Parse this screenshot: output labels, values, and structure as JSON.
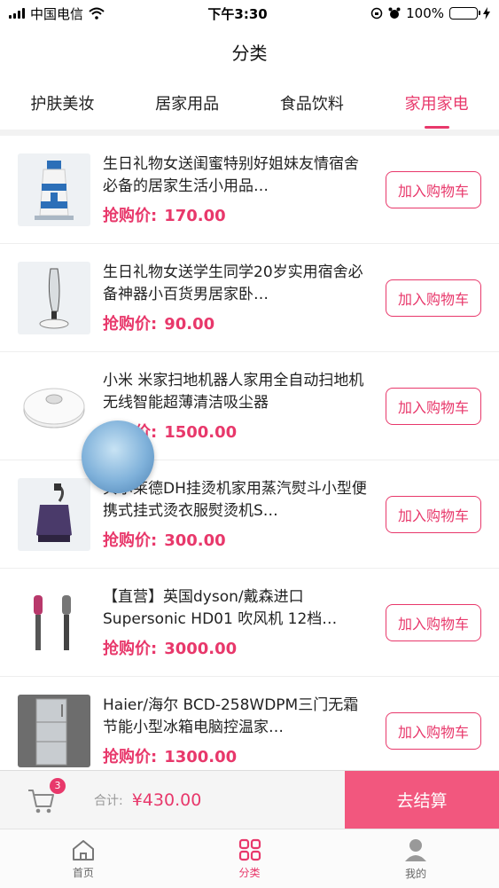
{
  "status_bar": {
    "carrier": "中国电信",
    "time": "下午3:30",
    "battery": "100%"
  },
  "header": {
    "title": "分类"
  },
  "tabs": [
    {
      "label": "护肤美妆",
      "active": false
    },
    {
      "label": "居家用品",
      "active": false
    },
    {
      "label": "食品饮料",
      "active": false
    },
    {
      "label": "家用家电",
      "active": true
    }
  ],
  "products": [
    {
      "title": "生日礼物女送闺蜜特别好姐妹友情宿舍必备的居家生活小用品…",
      "price_label": "抢购价:",
      "price": "170.00",
      "button": "加入购物车",
      "icon": "lighthouse-humidifier-icon"
    },
    {
      "title": "生日礼物女送学生同学20岁实用宿舍必备神器小百货男居家卧…",
      "price_label": "抢购价:",
      "price": "90.00",
      "button": "加入购物车",
      "icon": "tower-fan-icon"
    },
    {
      "title": "小米 米家扫地机器人家用全自动扫地机无线智能超薄清洁吸尘器",
      "price_label": "抢购价:",
      "price": "1500.00",
      "button": "加入购物车",
      "icon": "robot-vacuum-icon"
    },
    {
      "title": "贝尔莱德DH挂烫机家用蒸汽熨斗小型便携式挂式烫衣服熨烫机S…",
      "price_label": "抢购价:",
      "price": "300.00",
      "button": "加入购物车",
      "icon": "garment-steamer-icon"
    },
    {
      "title": "【直营】英国dyson/戴森进口Supersonic HD01 吹风机 12档…",
      "price_label": "抢购价:",
      "price": "3000.00",
      "button": "加入购物车",
      "icon": "hair-dryer-icon"
    },
    {
      "title": "Haier/海尔 BCD-258WDPM三门无霜节能小型冰箱电脑控温家…",
      "price_label": "抢购价:",
      "price": "1300.00",
      "button": "加入购物车",
      "icon": "refrigerator-icon"
    }
  ],
  "cart": {
    "badge": "3",
    "total_label": "合计:",
    "total": "¥430.00",
    "checkout": "去结算"
  },
  "tabbar": [
    {
      "label": "首页",
      "icon": "home-icon",
      "active": false
    },
    {
      "label": "分类",
      "icon": "category-icon",
      "active": true
    },
    {
      "label": "我的",
      "icon": "user-icon",
      "active": false
    }
  ],
  "colors": {
    "accent": "#e8386b",
    "checkout_bg": "#f2577e"
  }
}
